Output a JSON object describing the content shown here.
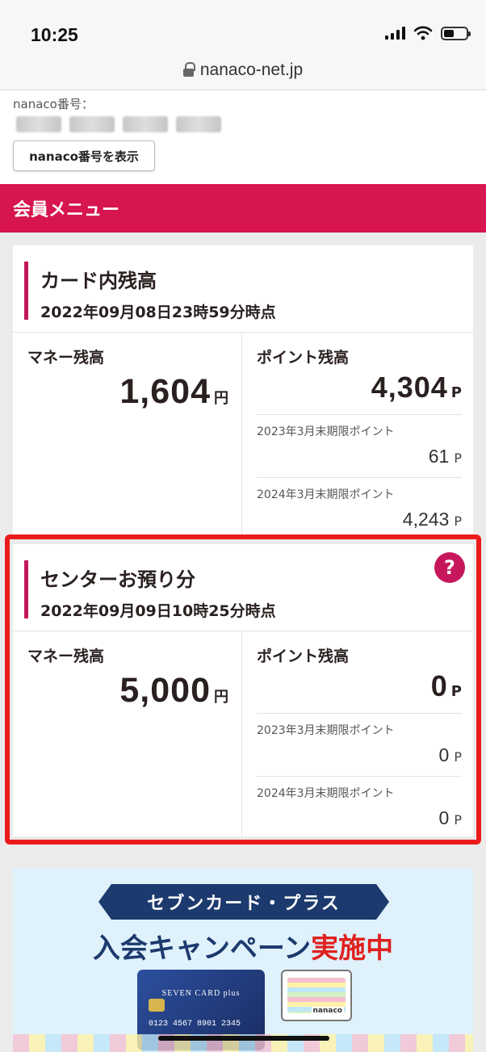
{
  "status": {
    "time": "10:25"
  },
  "browser": {
    "url": "nanaco-net.jp"
  },
  "info": {
    "label": "nanaco番号：",
    "show_button": "nanaco番号を表示"
  },
  "menu": {
    "title": "会員メニュー"
  },
  "card_balance": {
    "title": "カード内残高",
    "date": "2022年09月08日23時59分時点",
    "money_label": "マネー残高",
    "money_value": "1,604",
    "money_unit": "円",
    "point_label": "ポイント残高",
    "point_value": "4,304",
    "point_unit": "P",
    "sub_points": [
      {
        "label": "2023年3月末期限ポイント",
        "value": "61",
        "unit": "P"
      },
      {
        "label": "2024年3月末期限ポイント",
        "value": "4,243",
        "unit": "P"
      }
    ]
  },
  "center_balance": {
    "title": "センターお預り分",
    "date": "2022年09月09日10時25分時点",
    "help_icon": "?",
    "money_label": "マネー残高",
    "money_value": "5,000",
    "money_unit": "円",
    "point_label": "ポイント残高",
    "point_value": "0",
    "point_unit": "P",
    "sub_points": [
      {
        "label": "2023年3月末期限ポイント",
        "value": "0",
        "unit": "P"
      },
      {
        "label": "2024年3月末期限ポイント",
        "value": "0",
        "unit": "P"
      }
    ]
  },
  "banner": {
    "ribbon": "セブンカード・プラス",
    "headline_main": "入会キャンペーン",
    "headline_accent": "実施中",
    "card_brand": "SEVEN CARD plus",
    "card_number": "0123 4567 8901 2345",
    "nanaco_logo": "nanaco"
  }
}
